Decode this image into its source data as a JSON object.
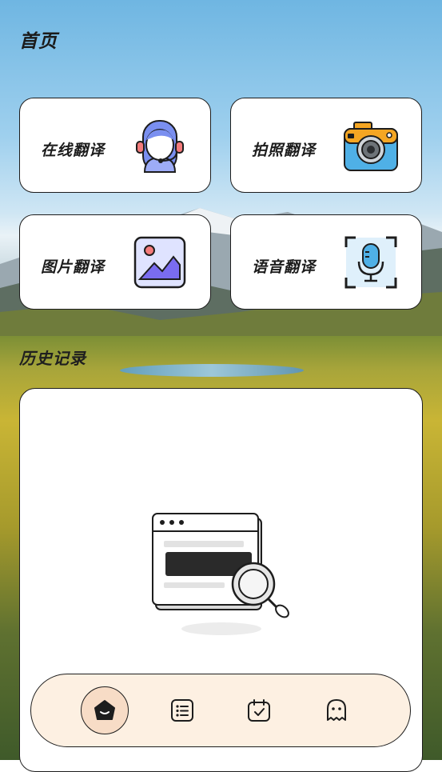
{
  "header": {
    "title": "首页"
  },
  "actions": [
    {
      "label": "在线翻译",
      "icon": "customer-service-icon"
    },
    {
      "label": "拍照翻译",
      "icon": "camera-icon"
    },
    {
      "label": "图片翻译",
      "icon": "image-icon"
    },
    {
      "label": "语音翻译",
      "icon": "microphone-icon"
    }
  ],
  "history": {
    "title": "历史记录"
  },
  "tabbar": {
    "items": [
      {
        "icon": "home-icon",
        "active": true
      },
      {
        "icon": "list-icon",
        "active": false
      },
      {
        "icon": "calendar-check-icon",
        "active": false
      },
      {
        "icon": "ghost-icon",
        "active": false
      }
    ]
  },
  "colors": {
    "tabbar_bg": "#fdf0e2",
    "tab_active_bg": "#f7dcc6",
    "card_border": "#1d1d1d"
  }
}
